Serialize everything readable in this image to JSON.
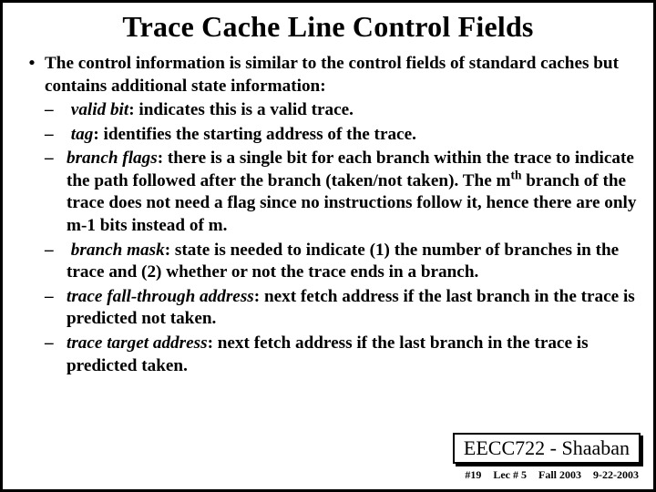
{
  "title": "Trace Cache Line Control Fields",
  "intro": "The control information is similar to the control fields of standard caches but contains additional state information:",
  "items": [
    {
      "term": "valid bit",
      "desc_html": ": indicates this is a valid trace."
    },
    {
      "term": "tag",
      "desc_html": ": identifies the starting address of the trace."
    },
    {
      "term": "branch flags",
      "desc_html": ": there is a single bit for each branch within the trace to indicate the path followed after the branch (taken/not taken). The m<sup>th</sup> branch of the trace does not need a flag since no instructions follow it, hence there are only m-1 bits instead of m."
    },
    {
      "term": "branch mask",
      "desc_html": ": state is needed to indicate (1) the number of branches in the trace and (2) whether or not the trace ends in a branch."
    },
    {
      "term": "trace fall-through address",
      "desc_html": ": next fetch address if the last branch in the trace is predicted not taken."
    },
    {
      "term": "trace target address",
      "desc_html": ": next fetch address if the last branch in the trace is predicted taken."
    }
  ],
  "footer_box": "EECC722 - Shaaban",
  "footer_line": {
    "a": "#19",
    "b": "Lec # 5",
    "c": "Fall 2003",
    "d": "9-22-2003"
  }
}
